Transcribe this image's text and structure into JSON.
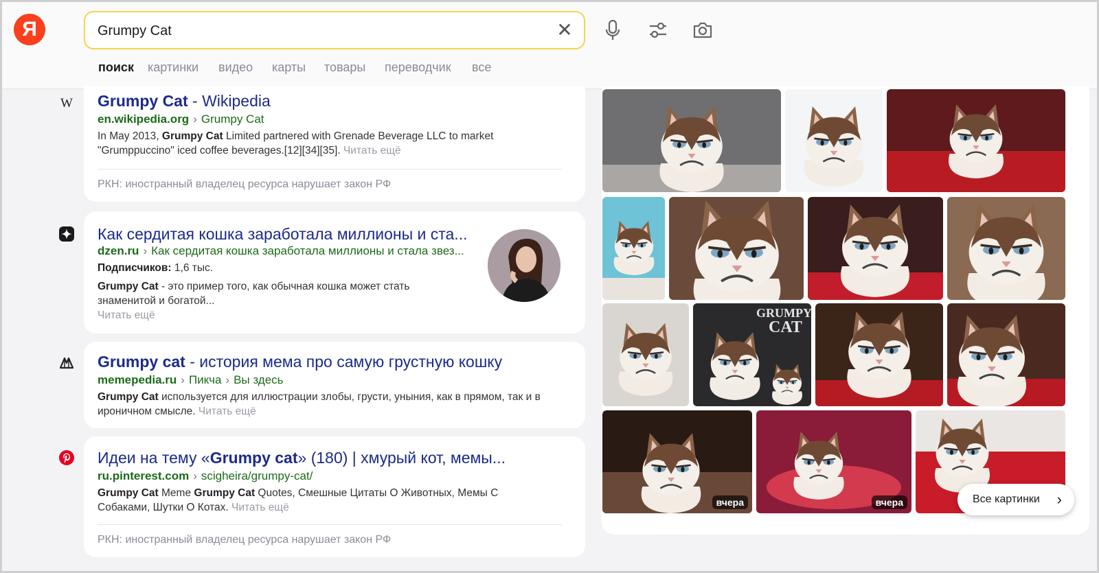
{
  "search": {
    "query": "Grumpy Cat",
    "clear_icon": "close-icon"
  },
  "logo": {
    "letter": "Я"
  },
  "tools": [
    "microphone-icon",
    "filters-icon",
    "camera-icon"
  ],
  "tabs": [
    "поиск",
    "картинки",
    "видео",
    "карты",
    "товары",
    "переводчик",
    "все"
  ],
  "active_tab": "поиск",
  "results": [
    {
      "favicon": "W",
      "title_bold": "Grumpy Cat",
      "title_rest": " - Wikipedia",
      "domain": "en.wikipedia.org",
      "path": [
        "Grumpy Cat"
      ],
      "snippet_pre": "In May 2013, ",
      "snippet_bold": "Grumpy Cat",
      "snippet_post": " Limited partnered with Grenade Beverage LLC to market",
      "snippet_line2": "\"Grumppuccino\" iced coffee beverages.[12][34][35]. ",
      "more": "Читать ещё",
      "notice": "РКН: иностранный владелец ресурса нарушает закон РФ"
    },
    {
      "favicon": "dzen-icon",
      "title": "Как сердитая кошка заработала миллионы и ста...",
      "domain": "dzen.ru",
      "path": [
        "Как сердитая кошка заработала миллионы и стала звез..."
      ],
      "subscribers_label": "Подписчиков:",
      "subscribers_value": " 1,6 тыс.",
      "snippet_bold": "Grumpy Cat",
      "snippet_post": " - это пример того, как обычная кошка может стать",
      "snippet_line2": "знаменитой и богатой...",
      "more": "Читать ещё"
    },
    {
      "favicon": "memepedia-icon",
      "title_bold": "Grumpy cat",
      "title_rest": " - история мема про самую грустную кошку",
      "domain": "memepedia.ru",
      "path": [
        "Пикча",
        "Вы здесь"
      ],
      "snippet_bold": "Grumpy Cat",
      "snippet_post": " используется для иллюстрации злобы, грусти, уныния, как в прямом, так и в",
      "snippet_line2": "ироничном смысле. ",
      "more": "Читать ещё"
    },
    {
      "favicon": "pinterest-icon",
      "title_pre": "Идеи на тему «",
      "title_bold": "Grumpy cat",
      "title_rest": "» (180) | хмурый кот, мемы...",
      "domain": "ru.pinterest.com",
      "path": [
        "scigheira/grumpy-cat/"
      ],
      "snippet_bold": "Grumpy Cat",
      "snippet_mid": " Meme ",
      "snippet_bold2": "Grumpy Cat",
      "snippet_post": " Quotes, Смешные Цитаты О Животных, Мемы С",
      "snippet_line2": "Собаками, Шутки О Котах. ",
      "more": "Читать ещё",
      "notice": "РКН: иностранный владелец ресурса нарушает закон РФ"
    }
  ],
  "images": {
    "badge": "вчера",
    "grumpy_text_1": "GRUMPY",
    "grumpy_text_2": "CAT",
    "all_images_label": "Все картинки"
  },
  "colors": {
    "brand": "#fc3f1d",
    "link": "#1c2a8a",
    "url": "#1a6b18",
    "search_border": "#f8d24c"
  }
}
